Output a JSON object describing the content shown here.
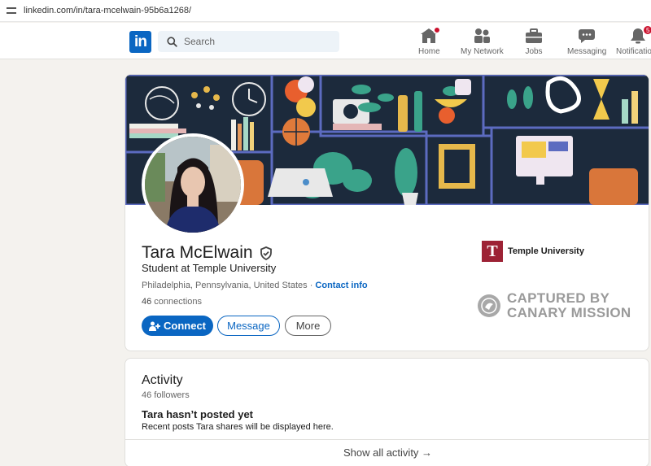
{
  "browser": {
    "url": "linkedin.com/in/tara-mcelwain-95b6a1268/"
  },
  "nav": {
    "logo_text": "in",
    "search_placeholder": "Search",
    "items": [
      {
        "label": "Home",
        "icon": "home-icon"
      },
      {
        "label": "My Network",
        "icon": "people-icon"
      },
      {
        "label": "Jobs",
        "icon": "briefcase-icon"
      },
      {
        "label": "Messaging",
        "icon": "chat-icon"
      },
      {
        "label": "Notifications",
        "icon": "bell-icon",
        "badge": "5"
      }
    ]
  },
  "profile": {
    "name": "Tara McElwain",
    "headline": "Student at Temple University",
    "location": "Philadelphia, Pennsylvania, United States",
    "separator": " · ",
    "contact_info": "Contact info",
    "connections_count": "46",
    "connections_label": " connections",
    "buttons": {
      "connect": "Connect",
      "message": "Message",
      "more": "More"
    },
    "school": {
      "logo_letter": "T",
      "name": "Temple University"
    },
    "watermark": {
      "line1": "CAPTURED BY",
      "line2": "CANARY MISSION"
    }
  },
  "activity": {
    "title": "Activity",
    "followers": "46 followers",
    "empty_title": "Tara hasn’t posted yet",
    "empty_subtitle": "Recent posts Tara shares will be displayed here.",
    "show_all": "Show all activity →"
  },
  "colors": {
    "brand": "#0a66c2",
    "badge": "#cb112d",
    "temple": "#9d2235"
  }
}
